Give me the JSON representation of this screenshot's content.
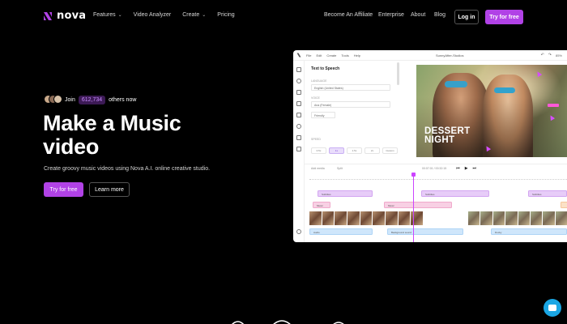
{
  "brand": {
    "name": "nova",
    "accent": "#b142e6"
  },
  "nav": {
    "links": [
      {
        "label": "Features",
        "dropdown": true
      },
      {
        "label": "Video Analyzer",
        "dropdown": false
      },
      {
        "label": "Create",
        "dropdown": true
      },
      {
        "label": "Pricing",
        "dropdown": false
      }
    ],
    "right_links": [
      "Become An Affiliate",
      "Enterprise",
      "About",
      "Blog"
    ],
    "login": "Log in",
    "try": "Try for free"
  },
  "hero": {
    "join_prefix": "Join",
    "join_count": "612,734",
    "join_suffix": "others now",
    "headline_line1": "Make a Music",
    "headline_line2": "video",
    "subtext": "Create groovy music videos using Nova A.I. online creative studio.",
    "cta_primary": "Try for free",
    "cta_secondary": "Learn more"
  },
  "editor": {
    "menu": [
      "File",
      "Edit",
      "Create",
      "Tools",
      "Help"
    ],
    "project_title": "SunnyAfter-Studios",
    "zoom": "85%",
    "panel": {
      "title": "Text to Speech",
      "language_label": "LANGUAGE",
      "language_value": "English (United States)",
      "voice_label": "VOICE",
      "voice_value": "Ana (Female)",
      "style_label": "",
      "style_value": "Friendly",
      "speed_label": "SPEED",
      "speed_options": [
        "0.5x",
        "1x",
        "1.5x",
        "2x",
        "Custom"
      ],
      "speed_selected": 1
    },
    "video": {
      "line1": "DESSERT",
      "line2": "NIGHT"
    },
    "controls": {
      "add_media": "Add media",
      "split": "Split",
      "timecode": "00:07:01 / 00:32:15"
    },
    "clips": {
      "subtitles": "Subtitles",
      "music": "Music",
      "audio": "Audio",
      "background": "Background sound",
      "ducky": "Ducky"
    }
  },
  "icons": {
    "chevron": "chevron-down-icon",
    "chat": "chat-bubble-icon",
    "logo": "nova-logo-icon"
  }
}
